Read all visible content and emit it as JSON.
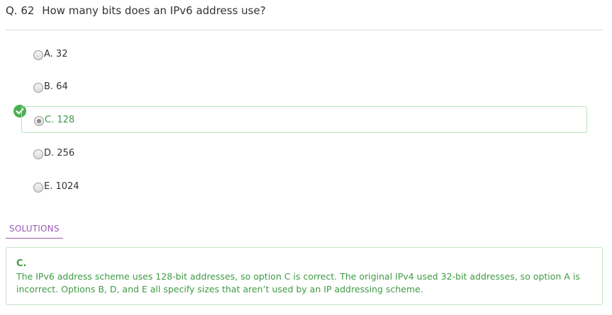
{
  "question": {
    "number": "Q. 62",
    "text": "How many bits does an IPv6 address use?"
  },
  "options": [
    {
      "label": "A. 32",
      "correct": false
    },
    {
      "label": "B. 64",
      "correct": false
    },
    {
      "label": "C. 128",
      "correct": true
    },
    {
      "label": "D. 256",
      "correct": false
    },
    {
      "label": "E. 1024",
      "correct": false
    }
  ],
  "solutions": {
    "tab_label": "SOLUTIONS",
    "answer": "C.",
    "explanation": "The IPv6 address scheme uses 128-bit addresses, so option C is correct. The original IPv4 used 32-bit addresses, so option A is incorrect. Options B, D, and E all specify sizes that aren’t used by an IP addressing scheme."
  },
  "colors": {
    "correct": "#3f9a44",
    "correct_border": "#b7e4bb",
    "check_badge": "#4caf50",
    "solutions_tab": "#9b59b6"
  },
  "icons": {
    "correct_marker": "check-circle-icon"
  }
}
